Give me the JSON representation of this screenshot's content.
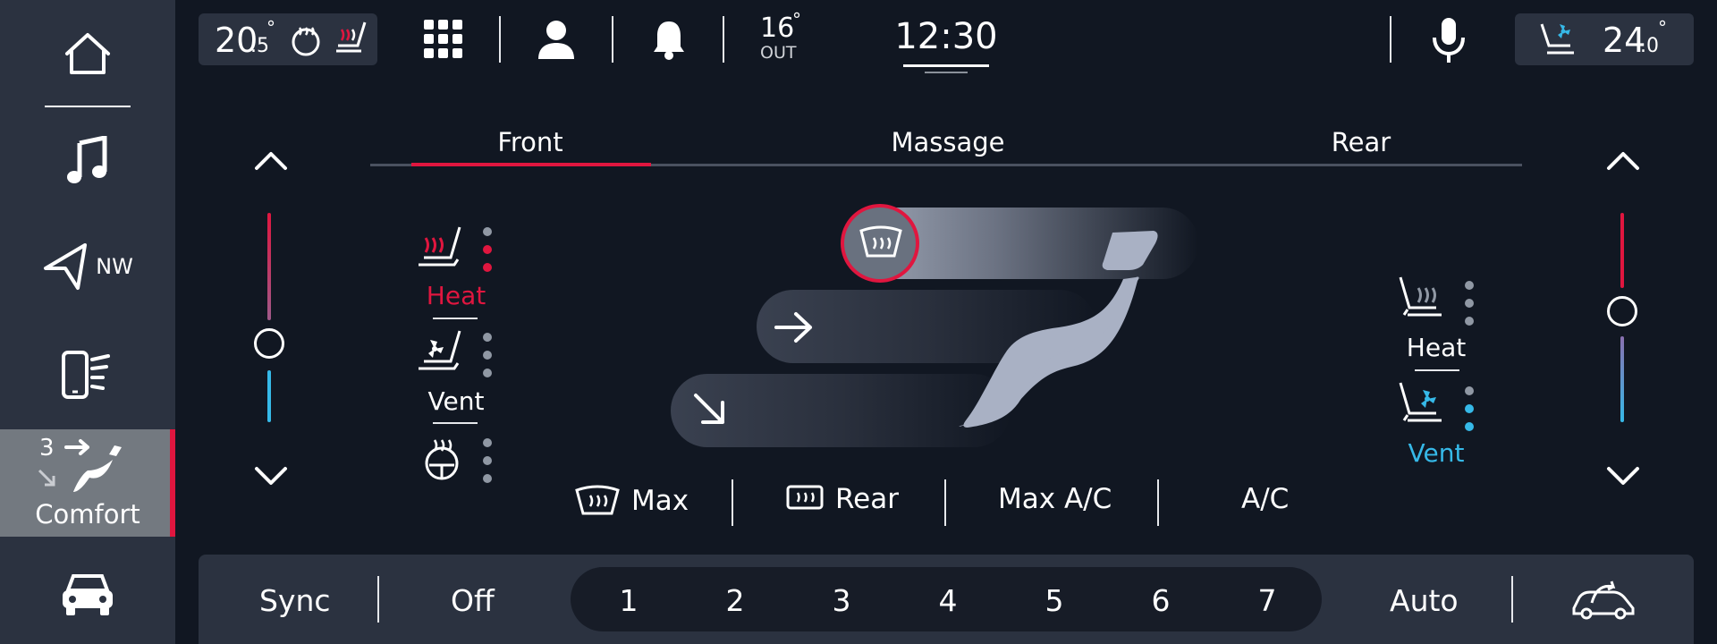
{
  "sidebar": {
    "nav_direction": "NW",
    "comfort_label": "Comfort",
    "comfort_level": "3"
  },
  "status": {
    "driver_temp_int": "20",
    "driver_temp_dec": ".5",
    "outside_temp": "16",
    "outside_label": "OUT",
    "time": "12:30",
    "passenger_temp_int": "24",
    "passenger_temp_dec": ".0"
  },
  "tabs": [
    {
      "label": "Front",
      "active": true
    },
    {
      "label": "Massage",
      "active": false
    },
    {
      "label": "Rear",
      "active": false
    }
  ],
  "driver_seat": {
    "heat_label": "Heat",
    "vent_label": "Vent",
    "heat_level": 2,
    "vent_level": 0,
    "steering_heat_level": 0
  },
  "passenger_seat": {
    "heat_label": "Heat",
    "vent_label": "Vent",
    "heat_level": 0,
    "vent_level": 2
  },
  "functions": {
    "max_defrost": "Max",
    "rear_defrost": "Rear",
    "max_ac": "Max A/C",
    "ac": "A/C"
  },
  "bottom": {
    "sync": "Sync",
    "off": "Off",
    "fan_speeds": [
      "1",
      "2",
      "3",
      "4",
      "5",
      "6",
      "7"
    ],
    "auto": "Auto"
  },
  "colors": {
    "accent_red": "#e0163f",
    "accent_blue": "#36b9e8",
    "panel": "#2b3240",
    "background": "#111722"
  }
}
